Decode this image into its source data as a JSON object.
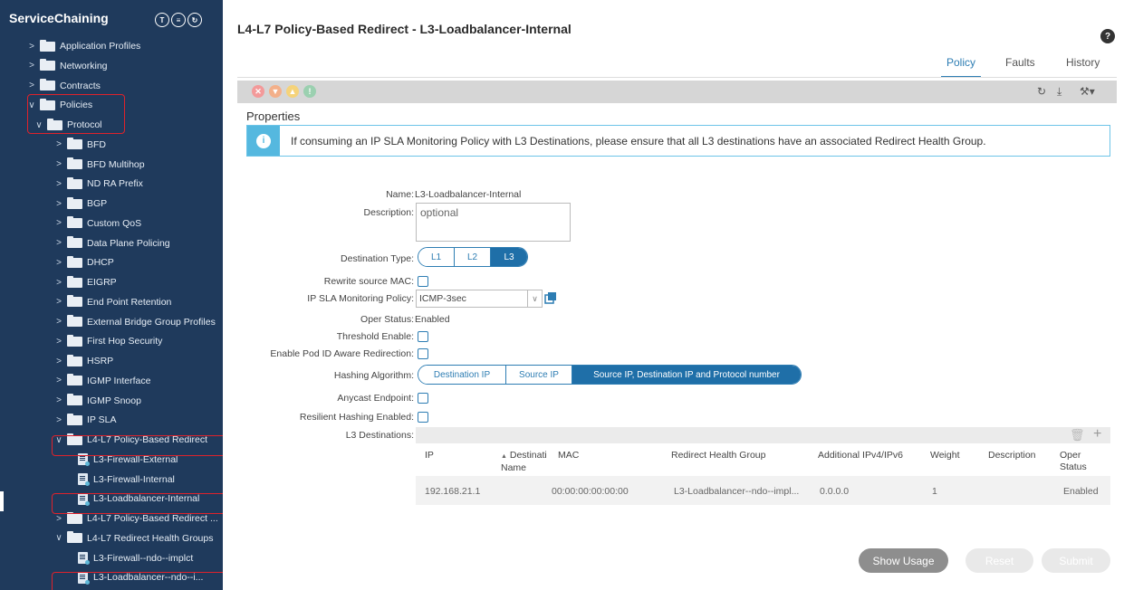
{
  "sidebar": {
    "title": "ServiceChaining",
    "header_icons": [
      "tenant-icon",
      "list-icon",
      "refresh-icon"
    ],
    "items": [
      {
        "label": "Application Profiles",
        "type": "folder",
        "level": 0,
        "expanded": false
      },
      {
        "label": "Networking",
        "type": "folder",
        "level": 0,
        "expanded": false
      },
      {
        "label": "Contracts",
        "type": "folder",
        "level": 0,
        "expanded": false
      },
      {
        "label": "Policies",
        "type": "folder",
        "level": 0,
        "expanded": true
      },
      {
        "label": "Protocol",
        "type": "folder",
        "level": 1,
        "expanded": true
      },
      {
        "label": "BFD",
        "type": "folder",
        "level": 2,
        "expanded": false
      },
      {
        "label": "BFD Multihop",
        "type": "folder",
        "level": 2,
        "expanded": false
      },
      {
        "label": "ND RA Prefix",
        "type": "folder",
        "level": 2,
        "expanded": false
      },
      {
        "label": "BGP",
        "type": "folder",
        "level": 2,
        "expanded": false
      },
      {
        "label": "Custom QoS",
        "type": "folder",
        "level": 2,
        "expanded": false
      },
      {
        "label": "Data Plane Policing",
        "type": "folder",
        "level": 2,
        "expanded": false
      },
      {
        "label": "DHCP",
        "type": "folder",
        "level": 2,
        "expanded": false
      },
      {
        "label": "EIGRP",
        "type": "folder",
        "level": 2,
        "expanded": false
      },
      {
        "label": "End Point Retention",
        "type": "folder",
        "level": 2,
        "expanded": false
      },
      {
        "label": "External Bridge Group Profiles",
        "type": "folder",
        "level": 2,
        "expanded": false
      },
      {
        "label": "First Hop Security",
        "type": "folder",
        "level": 2,
        "expanded": false
      },
      {
        "label": "HSRP",
        "type": "folder",
        "level": 2,
        "expanded": false
      },
      {
        "label": "IGMP Interface",
        "type": "folder",
        "level": 2,
        "expanded": false
      },
      {
        "label": "IGMP Snoop",
        "type": "folder",
        "level": 2,
        "expanded": false
      },
      {
        "label": "IP SLA",
        "type": "folder",
        "level": 2,
        "expanded": false
      },
      {
        "label": "L4-L7 Policy-Based Redirect",
        "type": "folder",
        "level": 2,
        "expanded": true
      },
      {
        "label": "L3-Firewall-External",
        "type": "doc",
        "level": 3
      },
      {
        "label": "L3-Firewall-Internal",
        "type": "doc",
        "level": 3
      },
      {
        "label": "L3-Loadbalancer-Internal",
        "type": "doc",
        "level": 3,
        "selected": true
      },
      {
        "label": "L4-L7 Policy-Based Redirect ...",
        "type": "folder",
        "level": 2,
        "expanded": false
      },
      {
        "label": "L4-L7 Redirect Health Groups",
        "type": "folder",
        "level": 2,
        "expanded": true
      },
      {
        "label": "L3-Firewall--ndo--implct",
        "type": "doc",
        "level": 3
      },
      {
        "label": "L3-Loadbalancer--ndo--i...",
        "type": "doc",
        "level": 3
      }
    ]
  },
  "main": {
    "title": "L4-L7 Policy-Based Redirect - L3-Loadbalancer-Internal",
    "tabs": [
      "Policy",
      "Faults",
      "History"
    ],
    "active_tab": "Policy",
    "properties_title": "Properties",
    "info_message": "If consuming an IP SLA Monitoring Policy with L3 Destinations, please ensure that all L3 destinations have an associated Redirect Health Group.",
    "form": {
      "name_label": "Name:",
      "name_value": "L3-Loadbalancer-Internal",
      "description_label": "Description:",
      "description_placeholder": "optional",
      "destination_type_label": "Destination Type:",
      "destination_type_options": [
        "L1",
        "L2",
        "L3"
      ],
      "destination_type_selected": "L3",
      "rewrite_mac_label": "Rewrite source MAC:",
      "ip_sla_label": "IP SLA Monitoring Policy:",
      "ip_sla_value": "ICMP-3sec",
      "oper_status_label": "Oper Status:",
      "oper_status_value": "Enabled",
      "threshold_label": "Threshold Enable:",
      "pod_id_label": "Enable Pod ID Aware Redirection:",
      "hashing_label": "Hashing Algorithm:",
      "hashing_options": [
        "Destination IP",
        "Source IP",
        "Source IP, Destination IP and Protocol number"
      ],
      "hashing_selected": "Source IP, Destination IP and Protocol number",
      "anycast_label": "Anycast Endpoint:",
      "resilient_label": "Resilient Hashing Enabled:",
      "l3_dest_label": "L3 Destinations:"
    },
    "table": {
      "columns": [
        "IP",
        "Destinati Name",
        "MAC",
        "Redirect Health Group",
        "Additional IPv4/IPv6",
        "Weight",
        "Description",
        "Oper Status"
      ],
      "col_dest_1": "Destinati",
      "col_dest_2": "Name",
      "col_oper_1": "Oper",
      "col_oper_2": "Status",
      "sort_indicator": "▲",
      "rows": [
        {
          "ip": "192.168.21.1",
          "dest_name": "",
          "mac": "00:00:00:00:00:00",
          "health_group": "L3-Loadbalancer--ndo--impl...",
          "additional": "0.0.0.0",
          "weight": "1",
          "description": "",
          "oper_status": "Enabled"
        }
      ]
    },
    "buttons": {
      "show_usage": "Show Usage",
      "reset": "Reset",
      "submit": "Submit"
    }
  },
  "colors": {
    "sidebar_bg": "#1f3a5c",
    "accent": "#2d7db3",
    "highlight": "#e0222b",
    "info": "#55b8df"
  }
}
